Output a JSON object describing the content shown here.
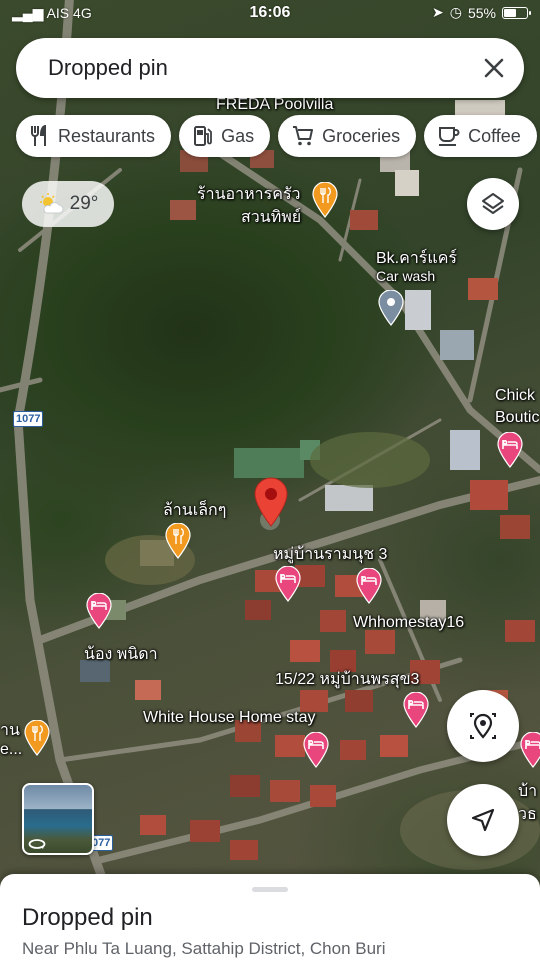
{
  "status_bar": {
    "carrier": "AIS 4G",
    "time": "16:06",
    "battery": "55%",
    "battery_level": 0.55
  },
  "search": {
    "query": "Dropped pin"
  },
  "chips": [
    {
      "label": "Restaurants",
      "icon": "fork-knife-icon"
    },
    {
      "label": "Gas",
      "icon": "gas-pump-icon"
    },
    {
      "label": "Groceries",
      "icon": "cart-icon"
    },
    {
      "label": "Coffee",
      "icon": "coffee-cup-icon"
    }
  ],
  "weather": {
    "temperature": "29°",
    "icon": "partly-cloudy-icon"
  },
  "map_labels": {
    "freda": "FREDA Poolvilla",
    "restaurant_1": "ร้านอาหารครัว",
    "restaurant_2": "สวนทิพย์",
    "bk_carcare": "Bk.คาร์แคร์",
    "car_wash": "Car wash",
    "chick_1": "Chick",
    "chick_2": "Boutic",
    "road_1077_a": "1077",
    "road_1077_b": "077",
    "laan_lek": "ล้านเล็กๆ",
    "village_3": "หมู่บ้านรามนุช 3",
    "whhomestay": "Whhomestay16",
    "nong_pinida": "น้อง พนิดา",
    "village_pornsuk": "15/22 หมู่บ้านพรสุข3",
    "white_house": "White House Home stay",
    "left_1": "าน",
    "left_2": "e...",
    "right_1": "บ้า",
    "right_2": "วธ"
  },
  "colors": {
    "pin_red": "#ea4335",
    "hotel_pink": "#e8467c",
    "restaurant_orange": "#f29a1f",
    "carwash_gray": "#7b8da0"
  },
  "sheet": {
    "title": "Dropped pin",
    "subtitle": "Near Phlu Ta Luang, Sattahip District, Chon Buri"
  }
}
